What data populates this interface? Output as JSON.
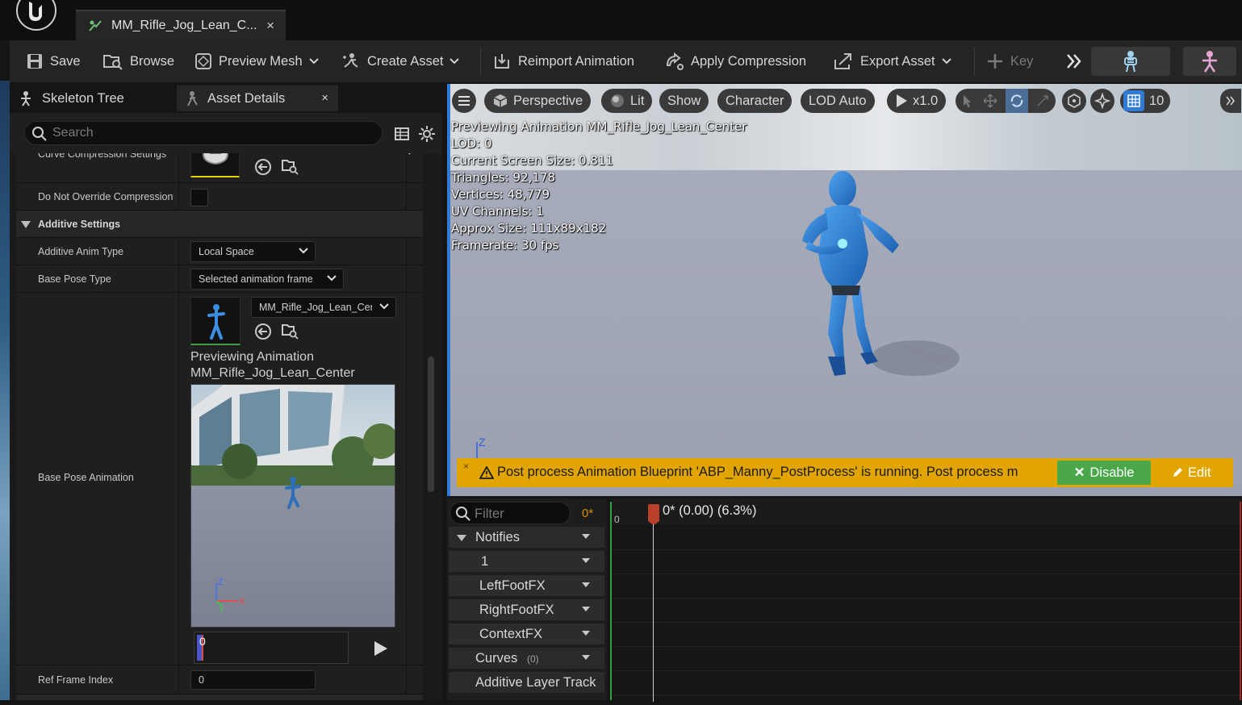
{
  "window": {
    "doc_tab_title": "MM_Rifle_Jog_Lean_C...",
    "doc_tab_close": "×"
  },
  "toolbar": {
    "save": "Save",
    "browse": "Browse",
    "preview_mesh": "Preview Mesh",
    "create_asset": "Create Asset",
    "reimport_animation": "Reimport Animation",
    "apply_compression": "Apply Compression",
    "export_asset": "Export Asset",
    "key": "Key"
  },
  "left_panel": {
    "tabs": {
      "skeleton_tree": "Skeleton Tree",
      "asset_details": "Asset Details",
      "close": "×"
    },
    "search": {
      "placeholder": "Search"
    },
    "properties": {
      "curve_compression_settings": "Curve Compression Settings",
      "do_not_override_compression": "Do Not Override Compression",
      "additive_settings": "Additive Settings",
      "additive_anim_type": {
        "label": "Additive Anim Type",
        "value": "Local Space"
      },
      "base_pose_type": {
        "label": "Base Pose Type",
        "value": "Selected animation frame"
      },
      "base_pose_animation": {
        "label": "Base Pose Animation",
        "asset": "MM_Rifle_Jog_Lean_Center",
        "preview_line1": "Previewing Animation",
        "preview_line2": "MM_Rifle_Jog_Lean_Center",
        "frame_value": "0"
      },
      "ref_frame_index": {
        "label": "Ref Frame Index",
        "value": "0"
      }
    }
  },
  "viewport": {
    "toolbar": {
      "perspective": "Perspective",
      "lit": "Lit",
      "show": "Show",
      "character": "Character",
      "lod": "LOD Auto",
      "play_rate": "x1.0",
      "grid_size": "10"
    },
    "stats": [
      "Previewing Animation MM_Rifle_Jog_Lean_Center",
      "LOD: 0",
      "Current Screen Size: 0.811",
      "Triangles: 92,178",
      "Vertices: 48,779",
      "UV Channels: 1",
      "Approx Size: 111x89x182",
      "Framerate: 30 fps"
    ],
    "axis_label": "Z",
    "warning": {
      "text": "Post process Animation Blueprint 'ABP_Manny_PostProcess' is running. Post process m",
      "disable": "Disable",
      "edit": "Edit",
      "close": "×"
    }
  },
  "timeline": {
    "filter_placeholder": "Filter",
    "frame_indicator": "0*",
    "ruler_zero": "0",
    "playhead_label": "0* (0.00) (6.3%)",
    "playhead_percent": 6.3,
    "tracks": {
      "notifies": "Notifies",
      "track_1": "1",
      "left_foot_fx": "LeftFootFX",
      "right_foot_fx": "RightFootFX",
      "context_fx": "ContextFX",
      "curves": "Curves",
      "curves_count": "(0)",
      "additive_layer_track": "Additive Layer Track"
    }
  },
  "colors": {
    "accent_blue": "#2f7bd6",
    "warning_yellow": "#e2a500",
    "disable_green": "#4aa84a",
    "playhead_red": "#b9412a",
    "frame_orange": "#e08a00"
  }
}
